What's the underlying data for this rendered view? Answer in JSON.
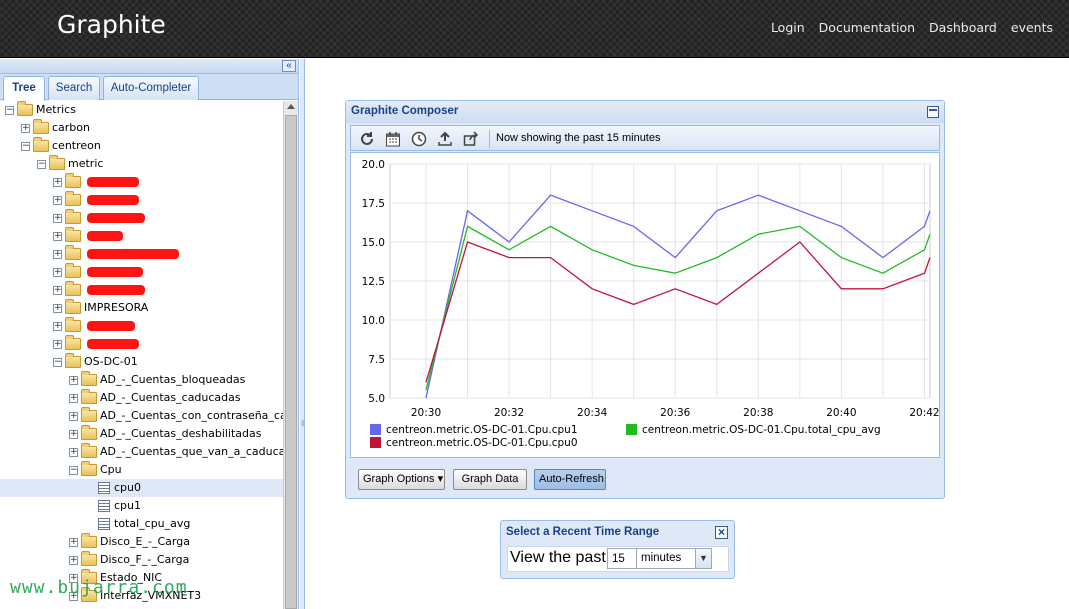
{
  "header": {
    "logo": "Graphite",
    "nav": [
      "Login",
      "Documentation",
      "Dashboard",
      "events"
    ]
  },
  "left_panel": {
    "collapse_glyph": "«",
    "tabs": [
      "Tree",
      "Search",
      "Auto-Completer"
    ],
    "active_tab": "Tree",
    "tree": [
      {
        "label": "Metrics",
        "depth": 0,
        "kind": "folder",
        "state": "expanded"
      },
      {
        "label": "carbon",
        "depth": 1,
        "kind": "folder",
        "state": "collapsed"
      },
      {
        "label": "centreon",
        "depth": 1,
        "kind": "folder",
        "state": "expanded"
      },
      {
        "label": "metric",
        "depth": 2,
        "kind": "folder",
        "state": "expanded"
      },
      {
        "label": "",
        "depth": 3,
        "kind": "folder",
        "state": "collapsed",
        "redacted": true
      },
      {
        "label": "",
        "depth": 3,
        "kind": "folder",
        "state": "collapsed",
        "redacted": true
      },
      {
        "label": "",
        "depth": 3,
        "kind": "folder",
        "state": "collapsed",
        "redacted": true
      },
      {
        "label": "",
        "depth": 3,
        "kind": "folder",
        "state": "collapsed",
        "redacted": true
      },
      {
        "label": "",
        "depth": 3,
        "kind": "folder",
        "state": "collapsed",
        "redacted": true
      },
      {
        "label": "",
        "depth": 3,
        "kind": "folder",
        "state": "collapsed",
        "redacted": true
      },
      {
        "label": "",
        "depth": 3,
        "kind": "folder",
        "state": "collapsed",
        "redacted": true
      },
      {
        "label": "IMPRESORA",
        "depth": 3,
        "kind": "folder",
        "state": "collapsed"
      },
      {
        "label": "",
        "depth": 3,
        "kind": "folder",
        "state": "collapsed",
        "redacted": true
      },
      {
        "label": "",
        "depth": 3,
        "kind": "folder",
        "state": "collapsed",
        "redacted": true
      },
      {
        "label": "OS-DC-01",
        "depth": 3,
        "kind": "folder",
        "state": "expanded"
      },
      {
        "label": "AD_-_Cuentas_bloqueadas",
        "depth": 4,
        "kind": "folder",
        "state": "collapsed"
      },
      {
        "label": "AD_-_Cuentas_caducadas",
        "depth": 4,
        "kind": "folder",
        "state": "collapsed"
      },
      {
        "label": "AD_-_Cuentas_con_contraseña_cadu",
        "depth": 4,
        "kind": "folder",
        "state": "collapsed"
      },
      {
        "label": "AD_-_Cuentas_deshabilitadas",
        "depth": 4,
        "kind": "folder",
        "state": "collapsed"
      },
      {
        "label": "AD_-_Cuentas_que_van_a_caducar",
        "depth": 4,
        "kind": "folder",
        "state": "collapsed"
      },
      {
        "label": "Cpu",
        "depth": 4,
        "kind": "folder",
        "state": "expanded"
      },
      {
        "label": "cpu0",
        "depth": 5,
        "kind": "leaf",
        "selected": true
      },
      {
        "label": "cpu1",
        "depth": 5,
        "kind": "leaf"
      },
      {
        "label": "total_cpu_avg",
        "depth": 5,
        "kind": "leaf"
      },
      {
        "label": "Disco_E_-_Carga",
        "depth": 4,
        "kind": "folder",
        "state": "collapsed"
      },
      {
        "label": "Disco_F_-_Carga",
        "depth": 4,
        "kind": "folder",
        "state": "collapsed"
      },
      {
        "label": "Estado_NIC",
        "depth": 4,
        "kind": "folder",
        "state": "collapsed"
      },
      {
        "label": "Interfaz_VMXNET3",
        "depth": 4,
        "kind": "folder",
        "state": "collapsed"
      }
    ]
  },
  "composer": {
    "title": "Graphite Composer",
    "toolbar_icons": [
      "refresh-icon",
      "calendar-icon",
      "clock-icon",
      "upload-icon",
      "share-icon"
    ],
    "status": "Now showing the past 15 minutes",
    "buttons": {
      "graph_options": "Graph Options",
      "graph_data": "Graph Data",
      "auto_refresh": "Auto-Refresh"
    }
  },
  "time_range": {
    "title": "Select a Recent Time Range",
    "label": "View the past",
    "value": "15",
    "unit": "minutes"
  },
  "watermark": "www.bujarra.com",
  "chart_data": {
    "type": "line",
    "title": "",
    "xlabel": "",
    "ylabel": "",
    "x": [
      "20:30",
      "20:31",
      "20:32",
      "20:33",
      "20:34",
      "20:35",
      "20:36",
      "20:37",
      "20:38",
      "20:39",
      "20:40",
      "20:41",
      "20:42",
      "20:43"
    ],
    "x_ticks": [
      "20:30",
      "20:32",
      "20:34",
      "20:36",
      "20:38",
      "20:40",
      "20:42"
    ],
    "y_ticks": [
      "20.0",
      "17.5",
      "15.0",
      "12.5",
      "10.0",
      "7.5",
      "5.0"
    ],
    "ylim": [
      5,
      20
    ],
    "grid": true,
    "legend_position": "bottom",
    "series": [
      {
        "name": "centreon.metric.OS-DC-01.Cpu.cpu1",
        "color": "#6666ee",
        "values": [
          5.0,
          17.0,
          15.0,
          18.0,
          17.0,
          16.0,
          14.0,
          17.0,
          18.0,
          17.0,
          16.0,
          14.0,
          16.0,
          17.0
        ]
      },
      {
        "name": "centreon.metric.OS-DC-01.Cpu.total_cpu_avg",
        "color": "#22bb22",
        "values": [
          5.5,
          16.0,
          14.5,
          16.0,
          14.5,
          13.5,
          13.0,
          14.0,
          15.5,
          16.0,
          14.0,
          13.0,
          14.5,
          15.5
        ]
      },
      {
        "name": "centreon.metric.OS-DC-01.Cpu.cpu0",
        "color": "#c0143c",
        "values": [
          6.0,
          15.0,
          14.0,
          14.0,
          12.0,
          11.0,
          12.0,
          11.0,
          13.0,
          15.0,
          12.0,
          12.0,
          13.0,
          14.0
        ]
      }
    ]
  }
}
